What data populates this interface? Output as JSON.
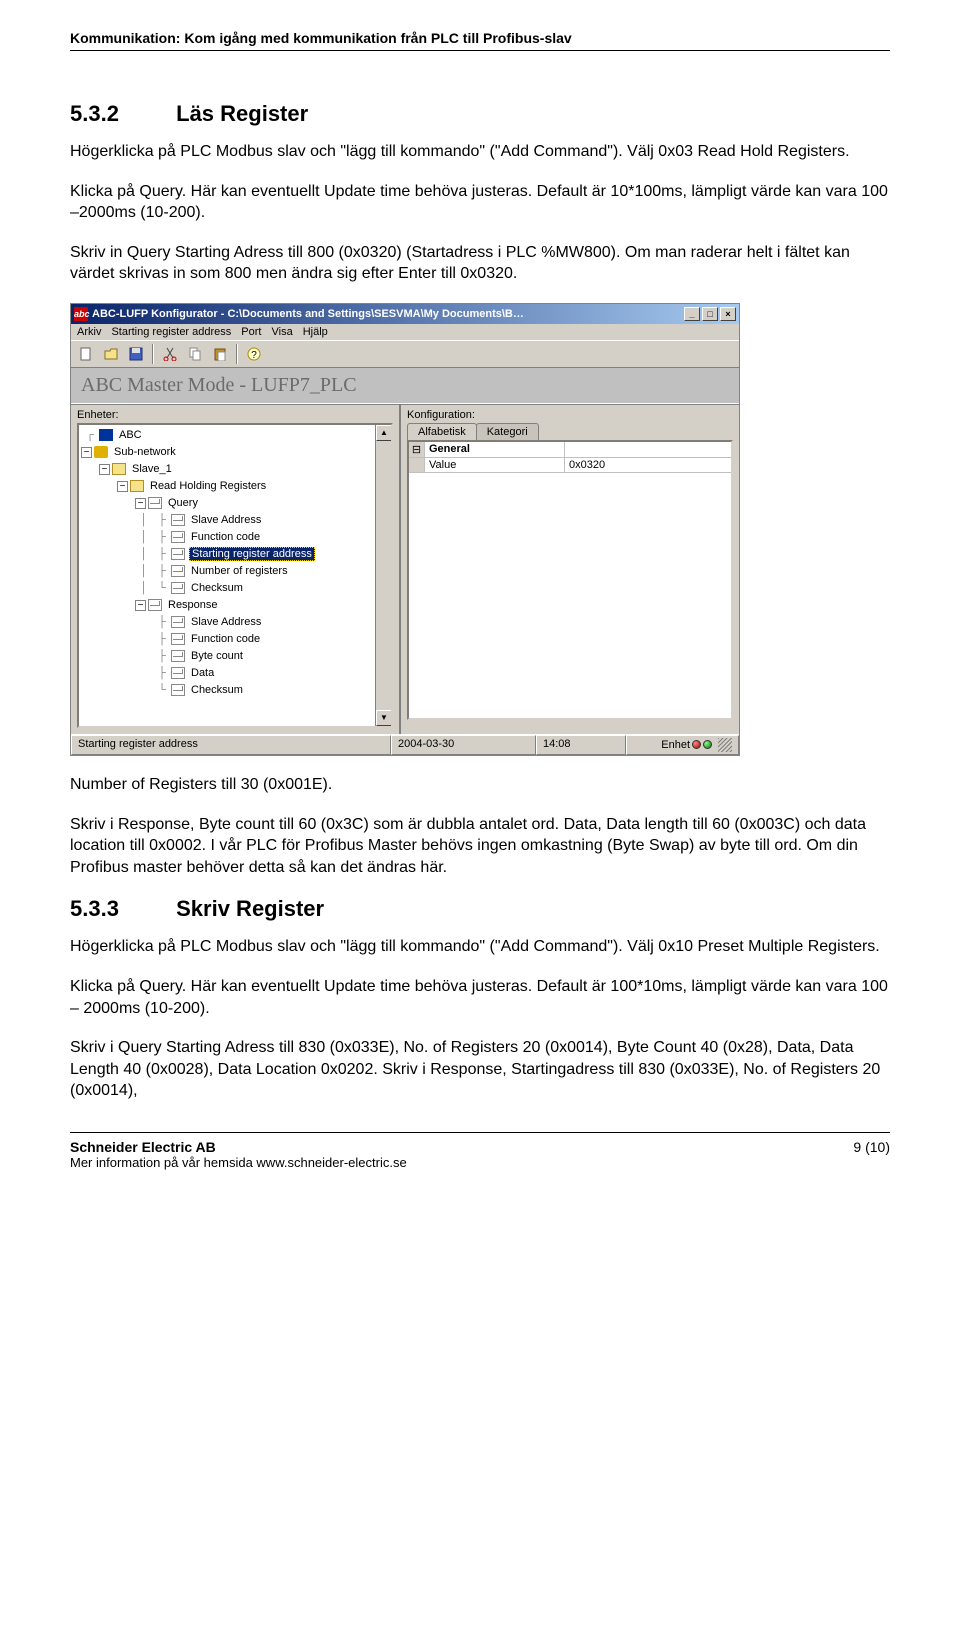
{
  "header": "Kommunikation: Kom igång med kommunikation från PLC till Profibus-slav",
  "s532": {
    "num": "5.3.2",
    "title": "Läs Register",
    "p1": "Högerklicka på PLC Modbus slav och \"lägg till kommando\" (\"Add Command\"). Välj 0x03 Read Hold Registers.",
    "p2": "Klicka på Query. Här kan eventuellt Update time behöva justeras. Default är 10*100ms, lämpligt värde kan vara 100 –2000ms (10-200).",
    "p3": "Skriv in Query Starting Adress till 800 (0x0320) (Startadress i PLC %MW800). Om man raderar helt i fältet kan värdet skrivas in som 800 men ändra sig efter Enter till 0x0320."
  },
  "app": {
    "title": "ABC-LUFP Konfigurator - C:\\Documents and Settings\\SESVMA\\My Documents\\B…",
    "menu": [
      "Arkiv",
      "Starting register address",
      "Port",
      "Visa",
      "Hjälp"
    ],
    "mode": "ABC Master Mode - LUFP7_PLC",
    "left_label": "Enheter:",
    "right_label": "Konfiguration:",
    "tabs": [
      "Alfabetisk",
      "Kategori"
    ],
    "tree": {
      "abc": "ABC",
      "subnet": "Sub-network",
      "slave": "Slave_1",
      "rhr": "Read Holding Registers",
      "query": "Query",
      "slave_addr": "Slave Address",
      "func_code": "Function code",
      "start_reg": "Starting register address",
      "num_reg": "Number of registers",
      "checksum": "Checksum",
      "response": "Response",
      "slave_addr2": "Slave Address",
      "func_code2": "Function code",
      "byte_count": "Byte count",
      "data": "Data",
      "checksum2": "Checksum"
    },
    "grid": {
      "general": "General",
      "value_k": "Value",
      "value_v": "0x0320"
    },
    "status": {
      "c1": "Starting register address",
      "c2": "2004-03-30",
      "c3": "14:08",
      "c4": "Enhet"
    }
  },
  "after_img": {
    "p1": "Number of Registers till 30 (0x001E).",
    "p2": "Skriv i Response, Byte count till 60 (0x3C) som är dubbla antalet ord. Data, Data length till 60 (0x003C) och data location till 0x0002. I vår PLC för Profibus Master behövs ingen omkastning (Byte Swap) av byte till ord. Om din Profibus master behöver detta så kan det ändras här."
  },
  "s533": {
    "num": "5.3.3",
    "title": "Skriv Register",
    "p1": "Högerklicka på PLC Modbus slav och \"lägg till kommando\" (\"Add Command\"). Välj 0x10 Preset Multiple Registers.",
    "p2": "Klicka på Query. Här kan eventuellt Update time behöva justeras. Default är 100*10ms, lämpligt värde kan vara 100 – 2000ms (10-200).",
    "p3": "Skriv i Query Starting Adress till 830 (0x033E), No. of Registers 20 (0x0014), Byte Count 40 (0x28), Data, Data Length 40 (0x0028), Data Location 0x0202. Skriv i Response, Startingadress till 830 (0x033E), No. of Registers 20 (0x0014),"
  },
  "footer": {
    "company": "Schneider Electric AB",
    "info": "Mer information på vår hemsida www.schneider-electric.se",
    "page": "9 (10)"
  }
}
